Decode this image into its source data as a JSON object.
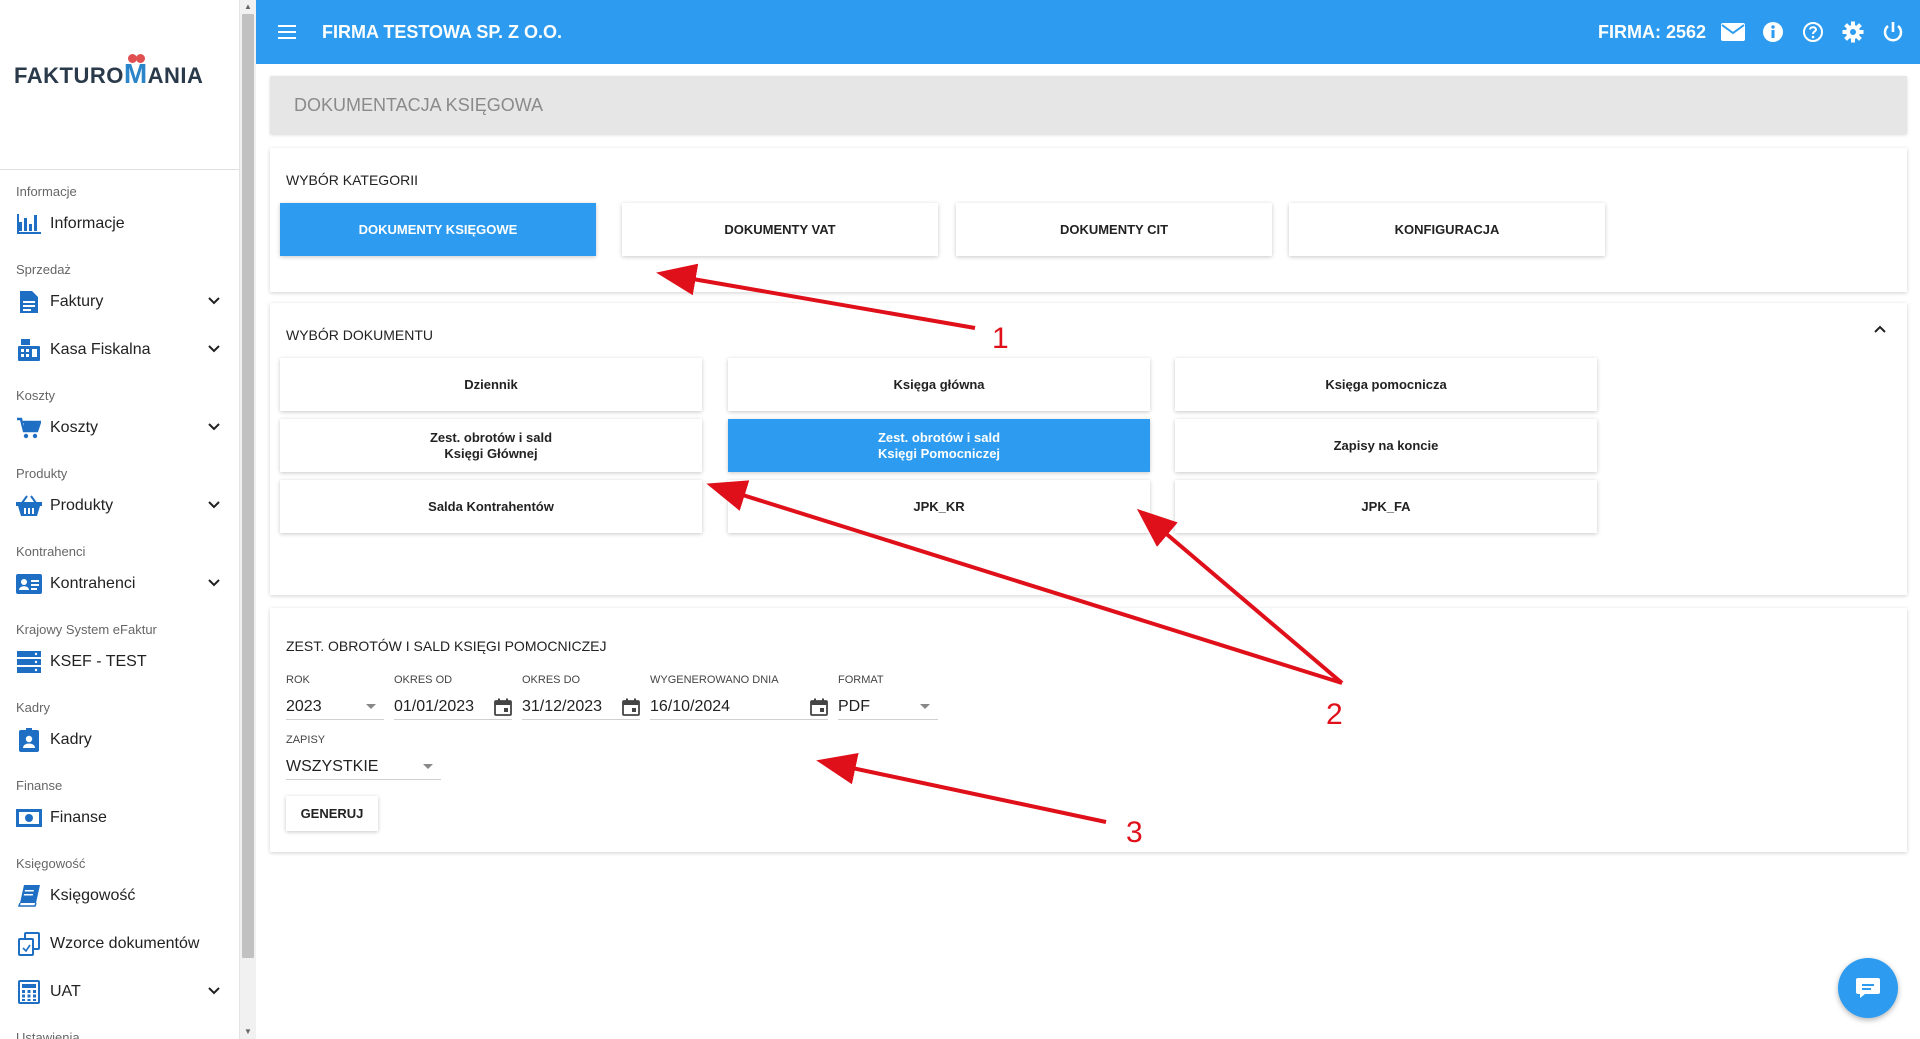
{
  "brand": {
    "logo_left": "FAKTURO",
    "logo_m": "M",
    "logo_right": "ANIA"
  },
  "header": {
    "company_name": "FIRMA TESTOWA SP. Z O.O.",
    "firma_label": "FIRMA: 2562"
  },
  "sidebar": {
    "sections": [
      {
        "title": "Informacje",
        "items": [
          {
            "label": "Informacje",
            "icon": "bar-chart-icon",
            "expandable": false
          }
        ]
      },
      {
        "title": "Sprzedaż",
        "items": [
          {
            "label": "Faktury",
            "icon": "document-icon",
            "expandable": true
          },
          {
            "label": "Kasa Fiskalna",
            "icon": "cash-register-icon",
            "expandable": true
          }
        ]
      },
      {
        "title": "Koszty",
        "items": [
          {
            "label": "Koszty",
            "icon": "cart-icon",
            "expandable": true
          }
        ]
      },
      {
        "title": "Produkty",
        "items": [
          {
            "label": "Produkty",
            "icon": "basket-icon",
            "expandable": true
          }
        ]
      },
      {
        "title": "Kontrahenci",
        "items": [
          {
            "label": "Kontrahenci",
            "icon": "contact-card-icon",
            "expandable": true
          }
        ]
      },
      {
        "title": "Krajowy System eFaktur",
        "items": [
          {
            "label": "KSEF - TEST",
            "icon": "server-icon",
            "expandable": false
          }
        ]
      },
      {
        "title": "Kadry",
        "items": [
          {
            "label": "Kadry",
            "icon": "person-badge-icon",
            "expandable": false
          }
        ]
      },
      {
        "title": "Finanse",
        "items": [
          {
            "label": "Finanse",
            "icon": "money-icon",
            "expandable": false
          }
        ]
      },
      {
        "title": "Księgowość",
        "items": [
          {
            "label": "Księgowość",
            "icon": "book-icon",
            "expandable": false
          },
          {
            "label": "Wzorce dokumentów",
            "icon": "copy-document-icon",
            "expandable": false
          },
          {
            "label": "UAT",
            "icon": "calculator-icon",
            "expandable": true
          }
        ]
      },
      {
        "title": "Ustawienia",
        "items": []
      }
    ]
  },
  "page": {
    "title": "DOKUMENTACJA KSIĘGOWA"
  },
  "category": {
    "title": "WYBÓR KATEGORII",
    "buttons": [
      "DOKUMENTY KSIĘGOWE",
      "DOKUMENTY VAT",
      "DOKUMENTY CIT",
      "KONFIGURACJA"
    ],
    "active_index": 0
  },
  "documents": {
    "title": "WYBÓR DOKUMENTU",
    "buttons": [
      {
        "line1": "Dziennik",
        "line2": ""
      },
      {
        "line1": "Księga główna",
        "line2": ""
      },
      {
        "line1": "Księga pomocnicza",
        "line2": ""
      },
      {
        "line1": "Zest. obrotów i sald",
        "line2": "Księgi Głównej"
      },
      {
        "line1": "Zest. obrotów i sald",
        "line2": "Księgi Pomocniczej"
      },
      {
        "line1": "Zapisy na koncie",
        "line2": ""
      },
      {
        "line1": "Salda Kontrahentów",
        "line2": ""
      },
      {
        "line1": "JPK_KR",
        "line2": ""
      },
      {
        "line1": "JPK_FA",
        "line2": ""
      }
    ],
    "active_index": 4
  },
  "form": {
    "title": "ZEST. OBROTÓW I SALD KSIĘGI POMOCNICZEJ",
    "rok": {
      "label": "ROK",
      "value": "2023"
    },
    "okres_od": {
      "label": "OKRES OD",
      "value": "01/01/2023"
    },
    "okres_do": {
      "label": "OKRES DO",
      "value": "31/12/2023"
    },
    "wygenerowano": {
      "label": "WYGENEROWANO DNIA",
      "value": "16/10/2024"
    },
    "format": {
      "label": "FORMAT",
      "value": "PDF"
    },
    "zapisy": {
      "label": "ZAPISY",
      "value": "WSZYSTKIE"
    },
    "generate_label": "GENERUJ"
  },
  "annotations": {
    "n1": "1",
    "n2": "2",
    "n3": "3"
  },
  "colors": {
    "primary": "#2d9cf0",
    "annotation": "#e0101a",
    "icon_blue": "#1e6fc4"
  }
}
